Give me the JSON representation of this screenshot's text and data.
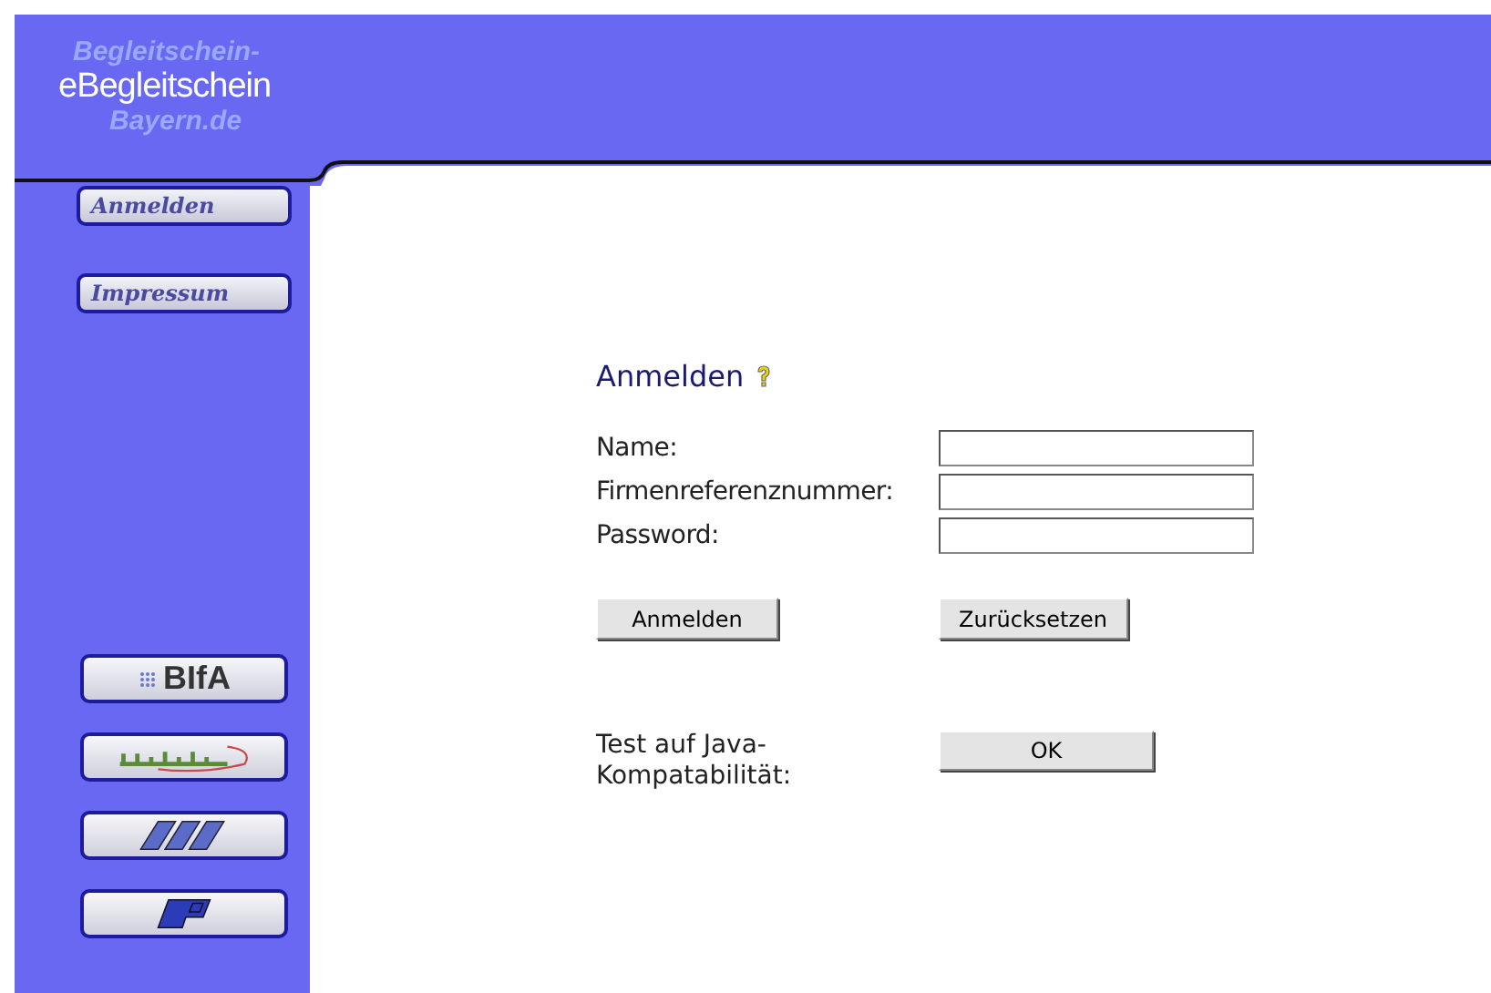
{
  "header": {
    "logo": "eBegleitschein",
    "logo_shadow": [
      "Begleitschein-",
      "Bayern.de"
    ]
  },
  "sidebar": {
    "nav": [
      "Anmelden",
      "Impressum"
    ],
    "partners": [
      {
        "kind": "text",
        "label": "BIfA"
      },
      {
        "kind": "curve"
      },
      {
        "kind": "stripes"
      },
      {
        "kind": "shield"
      }
    ]
  },
  "form": {
    "title": "Anmelden",
    "fields": [
      {
        "label": "Name:"
      },
      {
        "label": "Firmenreferenznummer:"
      },
      {
        "label": "Password:"
      }
    ],
    "buttons": [
      "Anmelden",
      "Zurücksetzen"
    ],
    "java_test": {
      "label": "Test auf Java-Kompatabilität:",
      "button": "OK"
    }
  }
}
